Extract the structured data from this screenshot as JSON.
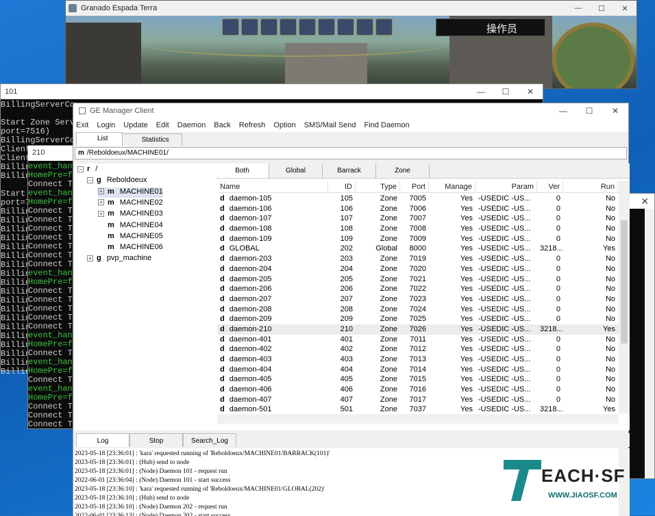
{
  "game": {
    "title": "Granado Espada Terra",
    "operator_label": "操作员",
    "controls": [
      "—",
      "☐",
      "✕"
    ]
  },
  "console101": {
    "title": "101",
    "controls": [
      "—",
      "☐",
      "✕"
    ],
    "lines": [
      {
        "t": "BillingServerConn",
        "c": "w"
      },
      {
        "t": "",
        "c": "w"
      },
      {
        "t": "Start Zone Serve",
        "c": "w"
      },
      {
        "t": "port=7516)",
        "c": "w"
      },
      {
        "t": "BillingServerConn",
        "c": "w"
      },
      {
        "t": "Client.",
        "c": "w"
      },
      {
        "t": "Client.",
        "c": "w"
      },
      {
        "t": "Billing",
        "c": "w"
      },
      {
        "t": "Billing",
        "c": "w"
      },
      {
        "t": "",
        "c": "w"
      },
      {
        "t": "Start",
        "c": "w"
      },
      {
        "t": "port=75",
        "c": "w"
      },
      {
        "t": "Billing",
        "c": "w"
      },
      {
        "t": "Billing",
        "c": "w"
      },
      {
        "t": "Billing",
        "c": "w"
      },
      {
        "t": "Billing",
        "c": "w"
      },
      {
        "t": "Billing",
        "c": "w"
      },
      {
        "t": "Billing",
        "c": "w"
      },
      {
        "t": "Billing",
        "c": "w"
      },
      {
        "t": "Billing",
        "c": "w"
      },
      {
        "t": "Billing",
        "c": "w"
      },
      {
        "t": "Billing",
        "c": "w"
      },
      {
        "t": "Billing",
        "c": "w"
      },
      {
        "t": "Billing",
        "c": "w"
      },
      {
        "t": "Billing",
        "c": "w"
      },
      {
        "t": "Billing",
        "c": "w"
      },
      {
        "t": "Billing",
        "c": "w"
      },
      {
        "t": "Billing",
        "c": "w"
      },
      {
        "t": "Billing",
        "c": "w"
      },
      {
        "t": "Billing",
        "c": "w"
      },
      {
        "t": "Billing",
        "c": "w"
      }
    ]
  },
  "console210": {
    "title": "210",
    "lines": [
      {
        "t": "event_hand",
        "c": "g"
      },
      {
        "t": "HomePre=fa",
        "c": "g"
      },
      {
        "t": "Connect To",
        "c": "w"
      },
      {
        "t": "event_hand",
        "c": "g"
      },
      {
        "t": "HomePre=fa",
        "c": "g"
      },
      {
        "t": "Connect To",
        "c": "w"
      },
      {
        "t": "Connect To",
        "c": "w"
      },
      {
        "t": "Connect To",
        "c": "w"
      },
      {
        "t": "Connect To",
        "c": "w"
      },
      {
        "t": "Connect To",
        "c": "w"
      },
      {
        "t": "Connect To",
        "c": "w"
      },
      {
        "t": "Connect To",
        "c": "w"
      },
      {
        "t": "event_hand",
        "c": "g"
      },
      {
        "t": "HomePre=fa",
        "c": "g"
      },
      {
        "t": "Connect To",
        "c": "w"
      },
      {
        "t": "Connect To",
        "c": "w"
      },
      {
        "t": "Connect To",
        "c": "w"
      },
      {
        "t": "Connect To",
        "c": "w"
      },
      {
        "t": "Connect To",
        "c": "w"
      },
      {
        "t": "event_hand",
        "c": "g"
      },
      {
        "t": "HomePre=fa",
        "c": "g"
      },
      {
        "t": "Connect To",
        "c": "w"
      },
      {
        "t": "event_hand",
        "c": "g"
      },
      {
        "t": "HomePre=fa",
        "c": "g"
      },
      {
        "t": "Connect To",
        "c": "w"
      },
      {
        "t": "event_hand",
        "c": "g"
      },
      {
        "t": "HomePre=fa",
        "c": "g"
      },
      {
        "t": "Connect To",
        "c": "w"
      },
      {
        "t": "Connect To",
        "c": "w"
      },
      {
        "t": "Connect To",
        "c": "w"
      }
    ]
  },
  "ge": {
    "title": "GE Manager Client",
    "controls": [
      "—",
      "☐",
      "✕"
    ],
    "menu": [
      "Exit",
      "Login",
      "Update",
      "Edit",
      "Daemon",
      "Back",
      "Refresh",
      "Option",
      "SMS/Mail Send",
      "Find Daemon"
    ],
    "tabs": [
      "List",
      "Statistics"
    ],
    "path_prefix": "m",
    "path": "/Reboldoeux/MACHINE01/",
    "tree": [
      {
        "exp": "⊟",
        "kind": "r",
        "label": "/"
      },
      {
        "exp": "⊟",
        "kind": "g",
        "label": "Reboldoeux"
      },
      {
        "exp": "⊞",
        "kind": "m",
        "label": "MACHINE01"
      },
      {
        "exp": "⊞",
        "kind": "m",
        "label": "MACHINE02"
      },
      {
        "exp": "⊞",
        "kind": "m",
        "label": "MACHINE03"
      },
      {
        "exp": "",
        "kind": "m",
        "label": "MACHINE04"
      },
      {
        "exp": "",
        "kind": "m",
        "label": "MACHINE05"
      },
      {
        "exp": "",
        "kind": "m",
        "label": "MACHINE06"
      },
      {
        "exp": "⊞",
        "kind": "g",
        "label": "pvp_machine"
      }
    ],
    "subtabs": [
      "Both",
      "Global",
      "Barrack",
      "Zone"
    ],
    "columns": [
      "Name",
      "ID",
      "Type",
      "Port",
      "Manage",
      "Param",
      "Ver",
      "Run"
    ],
    "rows": [
      [
        "d",
        "daemon-105",
        "105",
        "Zone",
        "7005",
        "Yes",
        "-USEDIC -US...",
        "0",
        "No"
      ],
      [
        "d",
        "daemon-106",
        "106",
        "Zone",
        "7006",
        "Yes",
        "-USEDIC -US...",
        "0",
        "No"
      ],
      [
        "d",
        "daemon-107",
        "107",
        "Zone",
        "7007",
        "Yes",
        "-USEDIC -US...",
        "0",
        "No"
      ],
      [
        "d",
        "daemon-108",
        "108",
        "Zone",
        "7008",
        "Yes",
        "-USEDIC -US...",
        "0",
        "No"
      ],
      [
        "d",
        "daemon-109",
        "109",
        "Zone",
        "7009",
        "Yes",
        "-USEDIC -US...",
        "0",
        "No"
      ],
      [
        "d",
        "GLOBAL",
        "202",
        "Global",
        "8000",
        "Yes",
        "-USEDIC -US...",
        "3218...",
        "Yes"
      ],
      [
        "d",
        "daemon-203",
        "203",
        "Zone",
        "7019",
        "Yes",
        "-USEDIC -US...",
        "0",
        "No"
      ],
      [
        "d",
        "daemon-204",
        "204",
        "Zone",
        "7020",
        "Yes",
        "-USEDIC -US...",
        "0",
        "No"
      ],
      [
        "d",
        "daemon-205",
        "205",
        "Zone",
        "7021",
        "Yes",
        "-USEDIC -US...",
        "0",
        "No"
      ],
      [
        "d",
        "daemon-206",
        "206",
        "Zone",
        "7022",
        "Yes",
        "-USEDIC -US...",
        "0",
        "No"
      ],
      [
        "d",
        "daemon-207",
        "207",
        "Zone",
        "7023",
        "Yes",
        "-USEDIC -US...",
        "0",
        "No"
      ],
      [
        "d",
        "daemon-208",
        "208",
        "Zone",
        "7024",
        "Yes",
        "-USEDIC -US...",
        "0",
        "No"
      ],
      [
        "d",
        "daemon-209",
        "209",
        "Zone",
        "7025",
        "Yes",
        "-USEDIC -US...",
        "0",
        "No"
      ],
      [
        "d",
        "daemon-210",
        "210",
        "Zone",
        "7026",
        "Yes",
        "-USEDIC -US...",
        "3218...",
        "Yes"
      ],
      [
        "d",
        "daemon-401",
        "401",
        "Zone",
        "7011",
        "Yes",
        "-USEDIC -US...",
        "0",
        "No"
      ],
      [
        "d",
        "daemon-402",
        "402",
        "Zone",
        "7012",
        "Yes",
        "-USEDIC -US...",
        "0",
        "No"
      ],
      [
        "d",
        "daemon-403",
        "403",
        "Zone",
        "7013",
        "Yes",
        "-USEDIC -US...",
        "0",
        "No"
      ],
      [
        "d",
        "daemon-404",
        "404",
        "Zone",
        "7014",
        "Yes",
        "-USEDIC -US...",
        "0",
        "No"
      ],
      [
        "d",
        "daemon-405",
        "405",
        "Zone",
        "7015",
        "Yes",
        "-USEDIC -US...",
        "0",
        "No"
      ],
      [
        "d",
        "daemon-406",
        "406",
        "Zone",
        "7016",
        "Yes",
        "-USEDIC -US...",
        "0",
        "No"
      ],
      [
        "d",
        "daemon-407",
        "407",
        "Zone",
        "7017",
        "Yes",
        "-USEDIC -US...",
        "0",
        "No"
      ],
      [
        "d",
        "daemon-501",
        "501",
        "Zone",
        "7037",
        "Yes",
        "-USEDIC -US...",
        "3218...",
        "Yes"
      ]
    ],
    "highlight_row": 13,
    "logtabs": [
      "Log",
      "Stop",
      "Search_Log"
    ],
    "log": [
      "2023-05-18 [23:36:01] : 'kara' requested running of 'Reboldoeux/MACHINE01/BARRACK(101)'",
      "2023-05-18 [23:36:01] : (Hub) send to node",
      "2023-05-18 [23:36:01] : (Node) Daemon 101 - request run",
      "2022-06-01 [23:36:04] : (Node) Daemon 101 - start success",
      "2023-05-18 [23:36:10] : 'kara' requested running of 'Reboldoeux/MACHINE01/GLOBAL(202)'",
      "2023-05-18 [23:36:10] : (Hub) send to node",
      "2023-05-18 [23:36:10] : (Node) Daemon 202 - request run",
      "2022-06-01 [23:36:13] : (Node) Daemon 202 - start success"
    ]
  },
  "watermark": {
    "brand": "EACH·SF",
    "site": "WWW.JIAOSF.COM",
    "color": "#1a8a8a"
  }
}
